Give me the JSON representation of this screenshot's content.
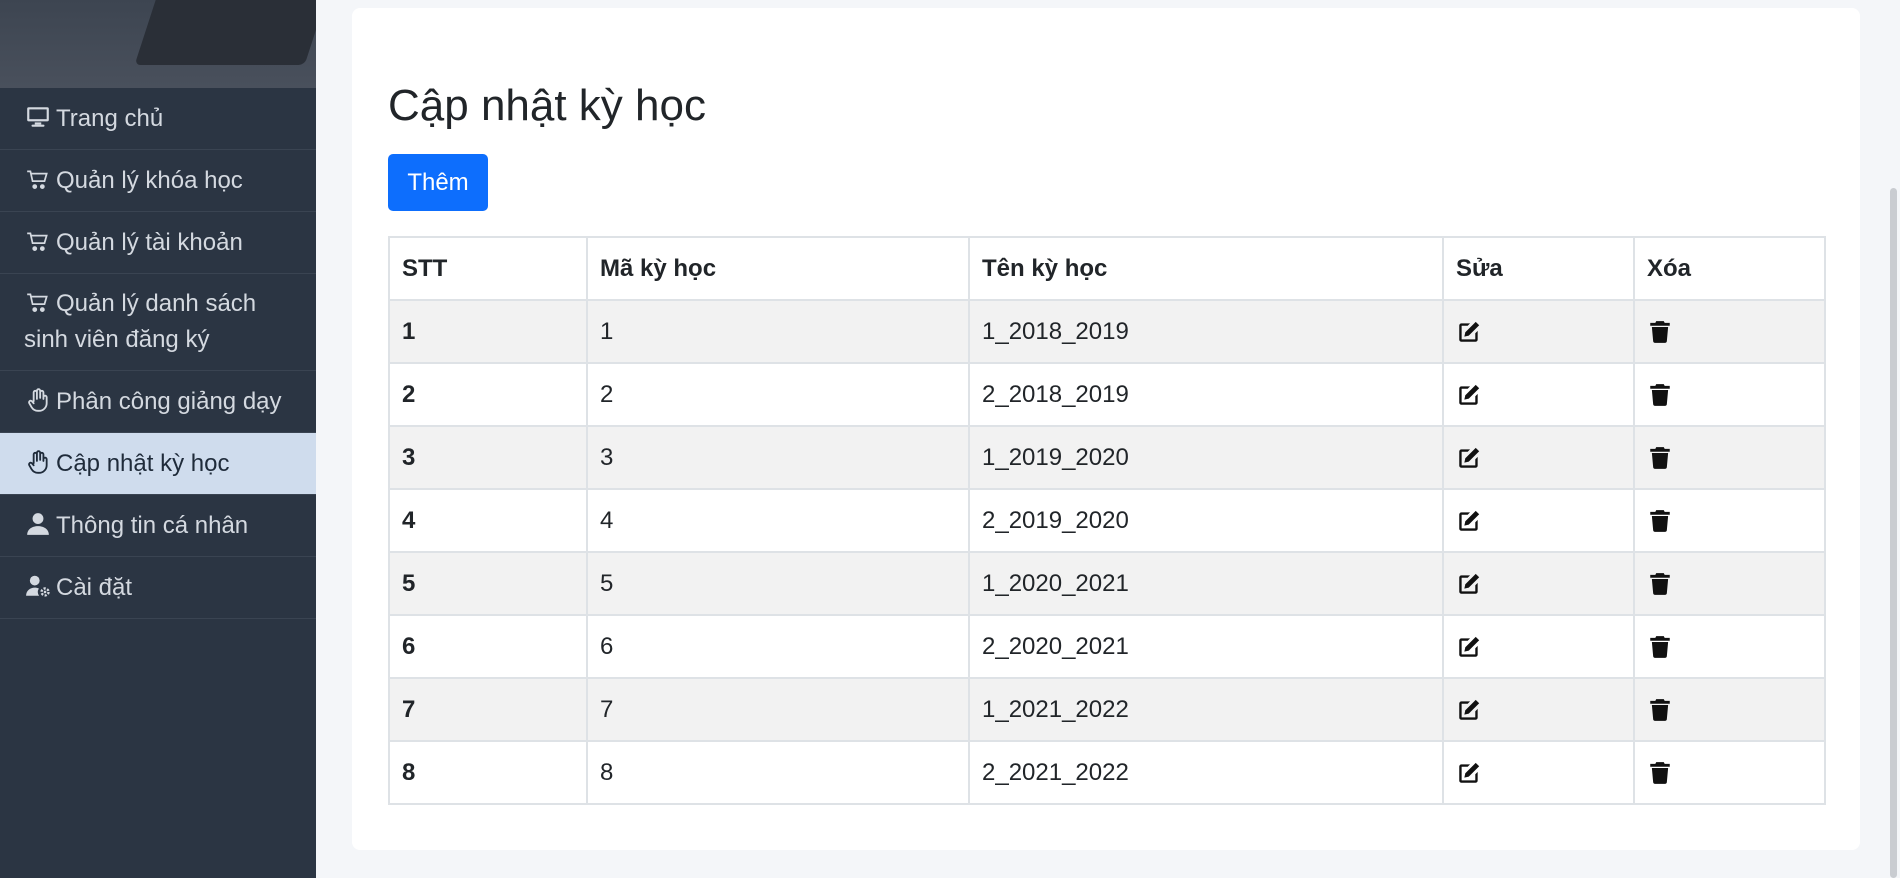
{
  "sidebar": {
    "items": [
      {
        "label": "Trang chủ",
        "icon": "desktop-icon"
      },
      {
        "label": "Quản lý khóa học",
        "icon": "cart-icon"
      },
      {
        "label": "Quản lý tài khoản",
        "icon": "cart-icon"
      },
      {
        "label": "Quản lý danh sách sinh viên đăng ký",
        "icon": "cart-icon"
      },
      {
        "label": "Phân công giảng dạy",
        "icon": "hand-icon"
      },
      {
        "label": "Cập nhật kỳ học",
        "icon": "hand-icon",
        "active": true
      },
      {
        "label": "Thông tin cá nhân",
        "icon": "user-icon"
      },
      {
        "label": "Cài đặt",
        "icon": "user-cog-icon"
      }
    ]
  },
  "main": {
    "title": "Cập nhật kỳ học",
    "add_button": "Thêm",
    "table": {
      "headers": [
        "STT",
        "Mã kỳ học",
        "Tên kỳ học",
        "Sửa",
        "Xóa"
      ],
      "rows": [
        {
          "stt": "1",
          "code": "1",
          "name": "1_2018_2019"
        },
        {
          "stt": "2",
          "code": "2",
          "name": "2_2018_2019"
        },
        {
          "stt": "3",
          "code": "3",
          "name": "1_2019_2020"
        },
        {
          "stt": "4",
          "code": "4",
          "name": "2_2019_2020"
        },
        {
          "stt": "5",
          "code": "5",
          "name": "1_2020_2021"
        },
        {
          "stt": "6",
          "code": "6",
          "name": "2_2020_2021"
        },
        {
          "stt": "7",
          "code": "7",
          "name": "1_2021_2022"
        },
        {
          "stt": "8",
          "code": "8",
          "name": "2_2021_2022"
        }
      ],
      "edit_icon": "edit-icon",
      "delete_icon": "trash-icon"
    }
  },
  "colors": {
    "sidebar_bg": "#2b3543",
    "sidebar_active_bg": "#cfdced",
    "primary": "#0d6efd",
    "page_bg": "#f4f6f9"
  }
}
